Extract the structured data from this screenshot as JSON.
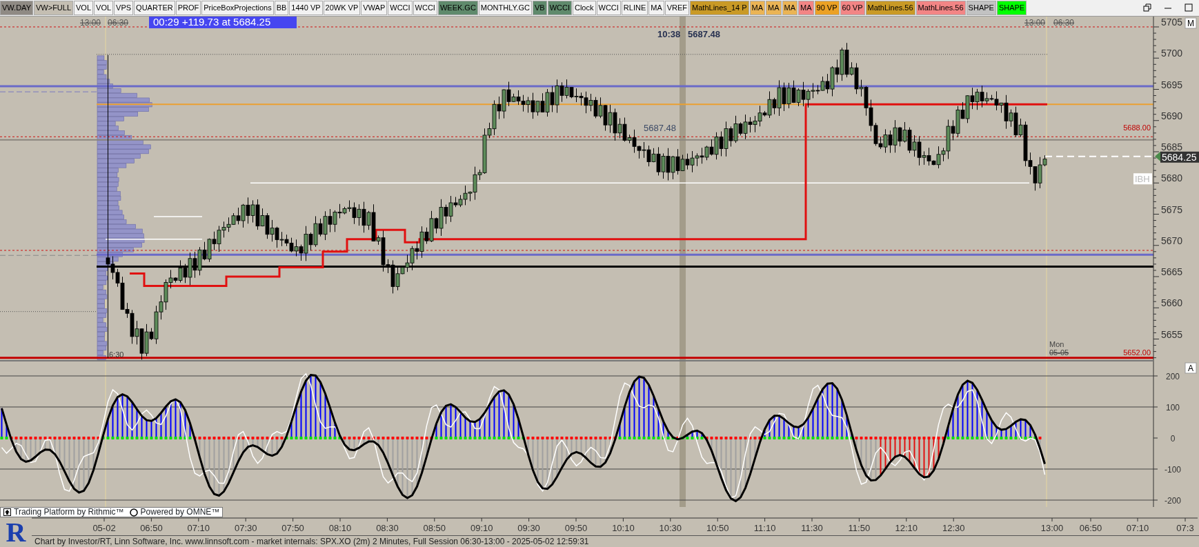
{
  "toolbar": {
    "buttons": [
      {
        "label": "VW.DAY",
        "color": "#8f8a84"
      },
      {
        "label": "VW>FULL",
        "color": "#c4beb2"
      },
      {
        "label": "VOL",
        "color": "#f2f2f2"
      },
      {
        "label": "VOL",
        "color": "#f2f2f2"
      },
      {
        "label": "VPS",
        "color": "#f2f2f2"
      },
      {
        "label": "QUARTER",
        "color": "#f2f2f2"
      },
      {
        "label": "PROF",
        "color": "#f2f2f2"
      },
      {
        "label": "PriceBoxProjections",
        "color": "#f2f2f2"
      },
      {
        "label": "BB",
        "color": "#f2f2f2"
      },
      {
        "label": "1440 VP",
        "color": "#f2f2f2"
      },
      {
        "label": "20WK VP",
        "color": "#f2f2f2"
      },
      {
        "label": "VWAP",
        "color": "#f2f2f2"
      },
      {
        "label": "WCCI",
        "color": "#f2f2f2"
      },
      {
        "label": "WCCI",
        "color": "#f2f2f2"
      },
      {
        "label": "WEEK.GC",
        "color": "#5f8a6c"
      },
      {
        "label": "MONTHLY.GC",
        "color": "#f2f2f2"
      },
      {
        "label": "VB",
        "color": "#5f8a6c"
      },
      {
        "label": "WCCI",
        "color": "#5f8a6c"
      },
      {
        "label": "Clock",
        "color": "#f2f2f2"
      },
      {
        "label": "WCCI",
        "color": "#f2f2f2"
      },
      {
        "label": "RLINE",
        "color": "#f2f2f2"
      },
      {
        "label": "MA",
        "color": "#f2f2f2"
      },
      {
        "label": "VREF",
        "color": "#f2f2f2"
      },
      {
        "label": "MathLines_14 P",
        "color": "#c99a26"
      },
      {
        "label": "MA",
        "color": "#eab455"
      },
      {
        "label": "MA",
        "color": "#eab455"
      },
      {
        "label": "MA",
        "color": "#eab455"
      },
      {
        "label": "MA",
        "color": "#f28585"
      },
      {
        "label": "90 VP",
        "color": "#eba125"
      },
      {
        "label": "60 VP",
        "color": "#f28585"
      },
      {
        "label": "MathLines.56",
        "color": "#c99a26"
      },
      {
        "label": "MathLines.56",
        "color": "#f28585"
      },
      {
        "label": "SHAPE",
        "color": "#c2c2c2"
      },
      {
        "label": "SHAPE",
        "color": "#00ff00"
      }
    ]
  },
  "price_pane": {
    "banner": "00:29  +119.73 at 5684.25",
    "session_labels_left": [
      "13:00",
      "06:30"
    ],
    "session_labels_right": [
      "13:00",
      "06:30"
    ],
    "annotation_time": "10:38",
    "annotation_price": "5687.48",
    "mid_label": "5687.48",
    "level_labels": [
      "5688.00",
      "5652.00"
    ],
    "ibh_label": "IBH",
    "last_price": "5684.25",
    "day_label": "Mon",
    "date_label": "05-05",
    "open_label": "6:30",
    "axis_labels": [
      "5705",
      "5700",
      "5695",
      "5690",
      "5685",
      "5680",
      "5675",
      "5670",
      "5665",
      "5660",
      "5655"
    ],
    "axis_button": "M"
  },
  "oscillator_pane": {
    "axis_labels": [
      "200",
      "100",
      "0",
      "-100",
      "-200"
    ],
    "axis_button": "A"
  },
  "attribution": {
    "rithmic": "Trading Platform by Rithmic™",
    "omne": "Powered by OMNE™"
  },
  "time_axis": {
    "labels": [
      "05-02",
      "06:50",
      "07:10",
      "07:30",
      "07:50",
      "08:10",
      "08:30",
      "08:50",
      "09:10",
      "09:30",
      "09:50",
      "10:10",
      "10:30",
      "10:50",
      "11:10",
      "11:30",
      "11:50",
      "12:10",
      "12:30",
      "13:00",
      "06:50",
      "07:10",
      "07:3"
    ]
  },
  "logo": {
    "letter": "R"
  },
  "footer": "Chart by Investor/RT, Linn Software, Inc. www.linnsoft.com - market internals: SPX.XO (2m) 2 Minutes, Full Session 06:30-13:00 - 2025-05-02 12:59:31"
}
